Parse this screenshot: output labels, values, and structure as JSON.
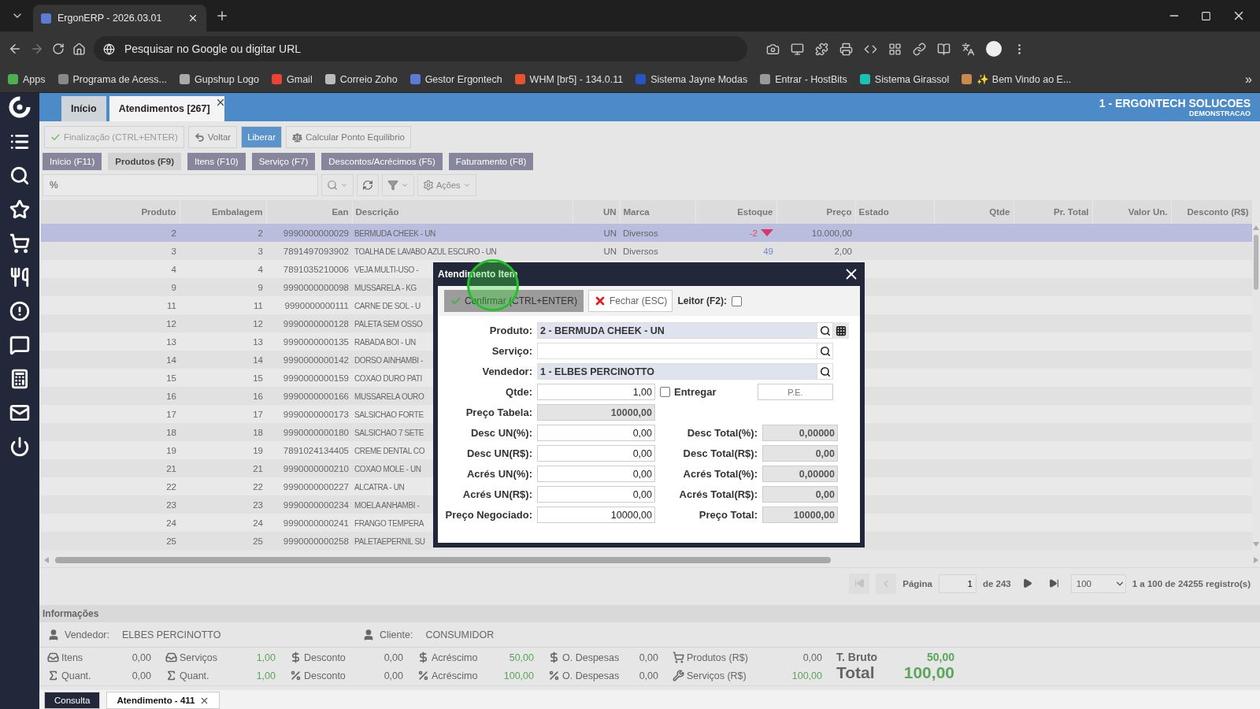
{
  "browser": {
    "tab_title": "ErgonERP - 2026.03.01",
    "address_placeholder": "Pesquisar no Google ou digitar URL",
    "bookmarks": [
      {
        "label": "Apps"
      },
      {
        "label": "Programa de Acess..."
      },
      {
        "label": "Gupshup Logo"
      },
      {
        "label": "Gmail"
      },
      {
        "label": "Correio Zoho"
      },
      {
        "label": "Gestor Ergontech"
      },
      {
        "label": "WHM [br5] - 134.0.11"
      },
      {
        "label": "Sistema Jayne Modas"
      },
      {
        "label": "Entrar - HostBits"
      },
      {
        "label": "Sistema Girassol"
      },
      {
        "label": "✨ Bem Vindo ao E..."
      }
    ],
    "more": "»"
  },
  "app_tabs": [
    {
      "label": "Início",
      "selected": false,
      "closable": false
    },
    {
      "label": "Atendimentos [267]",
      "selected": true,
      "closable": true
    }
  ],
  "company": {
    "name": "1 - ERGONTECH SOLUCOES",
    "subtitle": "DEMONSTRACAO"
  },
  "toolbar": [
    {
      "label": "Finalização (CTRL+ENTER)",
      "disabled": true,
      "primary": false
    },
    {
      "label": "Voltar",
      "disabled": false,
      "primary": false
    },
    {
      "label": "Liberar",
      "disabled": false,
      "primary": true
    },
    {
      "label": "Calcular Ponto Equilibrio",
      "disabled": false,
      "primary": false
    }
  ],
  "section_tabs": [
    {
      "label": "Início (F11)",
      "selected": false
    },
    {
      "label": "Produtos (F9)",
      "selected": true
    },
    {
      "label": "Itens (F10)",
      "selected": false
    },
    {
      "label": "Serviço (F7)",
      "selected": false
    },
    {
      "label": "Descontos/Acrécimos (F5)",
      "selected": false
    },
    {
      "label": "Faturamento (F8)",
      "selected": false
    }
  ],
  "search": {
    "value": "%",
    "actions": "Ações"
  },
  "table": {
    "columns": [
      "Produto",
      "Embalagem",
      "Ean",
      "Descrição",
      "UN",
      "Marca",
      "Estoque",
      "Preço",
      "Estado",
      "Qtde",
      "Pr. Total",
      "Valor Un.",
      "Desconto (R$)"
    ],
    "rows": [
      {
        "selected": true,
        "produto": "2",
        "embalagem": "2",
        "ean": "9990000000029",
        "descricao": "BERMUDA CHEEK - UN",
        "un": "UN",
        "marca": "Diversos",
        "estoque": "-2",
        "low_stock": true,
        "preco": "10.000,00"
      },
      {
        "selected": false,
        "produto": "3",
        "embalagem": "3",
        "ean": "7891497093902",
        "descricao": "TOALHA DE LAVABO AZUL ESCURO - UN",
        "un": "UN",
        "marca": "Diversos",
        "estoque": "49",
        "low_stock": false,
        "preco": "2,00"
      },
      {
        "selected": false,
        "produto": "4",
        "embalagem": "4",
        "ean": "7891035210006",
        "descricao": "VEJA MULTI-USO -"
      },
      {
        "selected": false,
        "produto": "9",
        "embalagem": "9",
        "ean": "9990000000098",
        "descricao": "MUSSARELA - KG"
      },
      {
        "selected": false,
        "produto": "11",
        "embalagem": "11",
        "ean": "9990000000111",
        "descricao": "CARNE DE SOL - U"
      },
      {
        "selected": false,
        "produto": "12",
        "embalagem": "12",
        "ean": "9990000000128",
        "descricao": "PALETA SEM OSSO"
      },
      {
        "selected": false,
        "produto": "13",
        "embalagem": "13",
        "ean": "9990000000135",
        "descricao": "RABADA BOI - UN"
      },
      {
        "selected": false,
        "produto": "14",
        "embalagem": "14",
        "ean": "9990000000142",
        "descricao": "DORSO AINHAMBI -"
      },
      {
        "selected": false,
        "produto": "15",
        "embalagem": "15",
        "ean": "9990000000159",
        "descricao": "COXAO DURO PATI"
      },
      {
        "selected": false,
        "produto": "16",
        "embalagem": "16",
        "ean": "9990000000166",
        "descricao": "MUSSARELA OURO"
      },
      {
        "selected": false,
        "produto": "17",
        "embalagem": "17",
        "ean": "9990000000173",
        "descricao": "SALSICHAO FORTE"
      },
      {
        "selected": false,
        "produto": "18",
        "embalagem": "18",
        "ean": "9990000000180",
        "descricao": "SALSICHAO 7 SETE"
      },
      {
        "selected": false,
        "produto": "19",
        "embalagem": "19",
        "ean": "7891024134405",
        "descricao": "CREME DENTAL CO"
      },
      {
        "selected": false,
        "produto": "21",
        "embalagem": "21",
        "ean": "9990000000210",
        "descricao": "COXAO MOLE - UN"
      },
      {
        "selected": false,
        "produto": "22",
        "embalagem": "22",
        "ean": "9990000000227",
        "descricao": "ALCATRA - UN"
      },
      {
        "selected": false,
        "produto": "23",
        "embalagem": "23",
        "ean": "9990000000234",
        "descricao": "MOELA ANHAMBI -"
      },
      {
        "selected": false,
        "produto": "24",
        "embalagem": "24",
        "ean": "9990000000241",
        "descricao": "FRANGO TEMPERA"
      },
      {
        "selected": false,
        "produto": "25",
        "embalagem": "25",
        "ean": "9990000000258",
        "descricao": "PALETAEPERNIL SU"
      }
    ]
  },
  "pagination": {
    "back_disabled": true,
    "page_label": "Página",
    "page": "1",
    "of": "de 243",
    "page_size": "100",
    "summary": "1 a 100 de 24255 registro(s)"
  },
  "info": {
    "title": "Informações",
    "vendedor_label": "Vendedor:",
    "vendedor": "ELBES PERCINOTTO",
    "cliente_label": "Cliente:",
    "cliente": "CONSUMIDOR",
    "stats": [
      [
        {
          "label": "Itens",
          "value": "0,00",
          "highlight": false
        },
        {
          "label": "Quant.",
          "value": "0,00",
          "highlight": false
        }
      ],
      [
        {
          "label": "Serviços",
          "value": "1,00",
          "highlight": true
        },
        {
          "label": "Quant.",
          "value": "1,00",
          "highlight": true
        }
      ],
      [
        {
          "label": "Desconto",
          "value": "0,00",
          "highlight": false
        },
        {
          "label": "Desconto",
          "value": "0,00",
          "highlight": false
        }
      ],
      [
        {
          "label": "Acréscimo",
          "value": "50,00",
          "highlight": true
        },
        {
          "label": "Acréscimo",
          "value": "100,00",
          "highlight": true
        }
      ],
      [
        {
          "label": "O. Despesas",
          "value": "0,00",
          "highlight": false
        },
        {
          "label": "O. Despesas",
          "value": "0,00",
          "highlight": false
        }
      ],
      [
        {
          "label": "Produtos (R$)",
          "value": "0,00",
          "highlight": false
        },
        {
          "label": "Serviços (R$)",
          "value": "100,00",
          "highlight": true
        }
      ]
    ],
    "totals": [
      {
        "label": "T. Bruto",
        "value": "50,00",
        "emphasis": false
      },
      {
        "label": "Total",
        "value": "100,00",
        "emphasis": true
      }
    ]
  },
  "bottom_tabs": [
    {
      "label": "Consulta",
      "selected": false,
      "closable": false
    },
    {
      "label": "Atendimento - 411",
      "selected": true,
      "closable": true
    }
  ],
  "modal": {
    "title": "Atendimento Item",
    "confirm": "Confirmar (CTRL+ENTER)",
    "close": "Fechar (ESC)",
    "reader_label": "Leitor (F2):",
    "reader_checked": false,
    "lookups": [
      {
        "label": "Produto:",
        "value": "2 - BERMUDA CHEEK - UN",
        "grid_button": true
      },
      {
        "label": "Serviço:",
        "grid_button": false
      },
      {
        "label": "Vendedor:",
        "value": "1 - ELBES PERCINOTTO",
        "grid_button": false
      }
    ],
    "qtde": {
      "label": "Qtde:",
      "value": "1,00"
    },
    "entregar": {
      "label": "Entregar",
      "checked": false
    },
    "pe_button": "P.E.",
    "preco_tabela": {
      "label": "Preço Tabela:",
      "value": "10000,00"
    },
    "pairs": [
      {
        "left": {
          "label": "Desc UN(%):",
          "value": "0,00"
        },
        "right": {
          "label": "Desc Total(%):",
          "value": "0,00000"
        }
      },
      {
        "left": {
          "label": "Desc UN(R$):",
          "value": "0,00"
        },
        "right": {
          "label": "Desc Total(R$):",
          "value": "0,00"
        }
      },
      {
        "left": {
          "label": "Acrés UN(%):",
          "value": "0,00"
        },
        "right": {
          "label": "Acrés Total(%):",
          "value": "0,00000"
        }
      },
      {
        "left": {
          "label": "Acrés UN(R$):",
          "value": "0,00"
        },
        "right": {
          "label": "Acrés Total(R$):",
          "value": "0,00"
        }
      },
      {
        "left": {
          "label": "Preço Negociado:",
          "value": "10000,00"
        },
        "right": {
          "label": "Preço Total:",
          "value": "10000,00"
        }
      }
    ]
  }
}
